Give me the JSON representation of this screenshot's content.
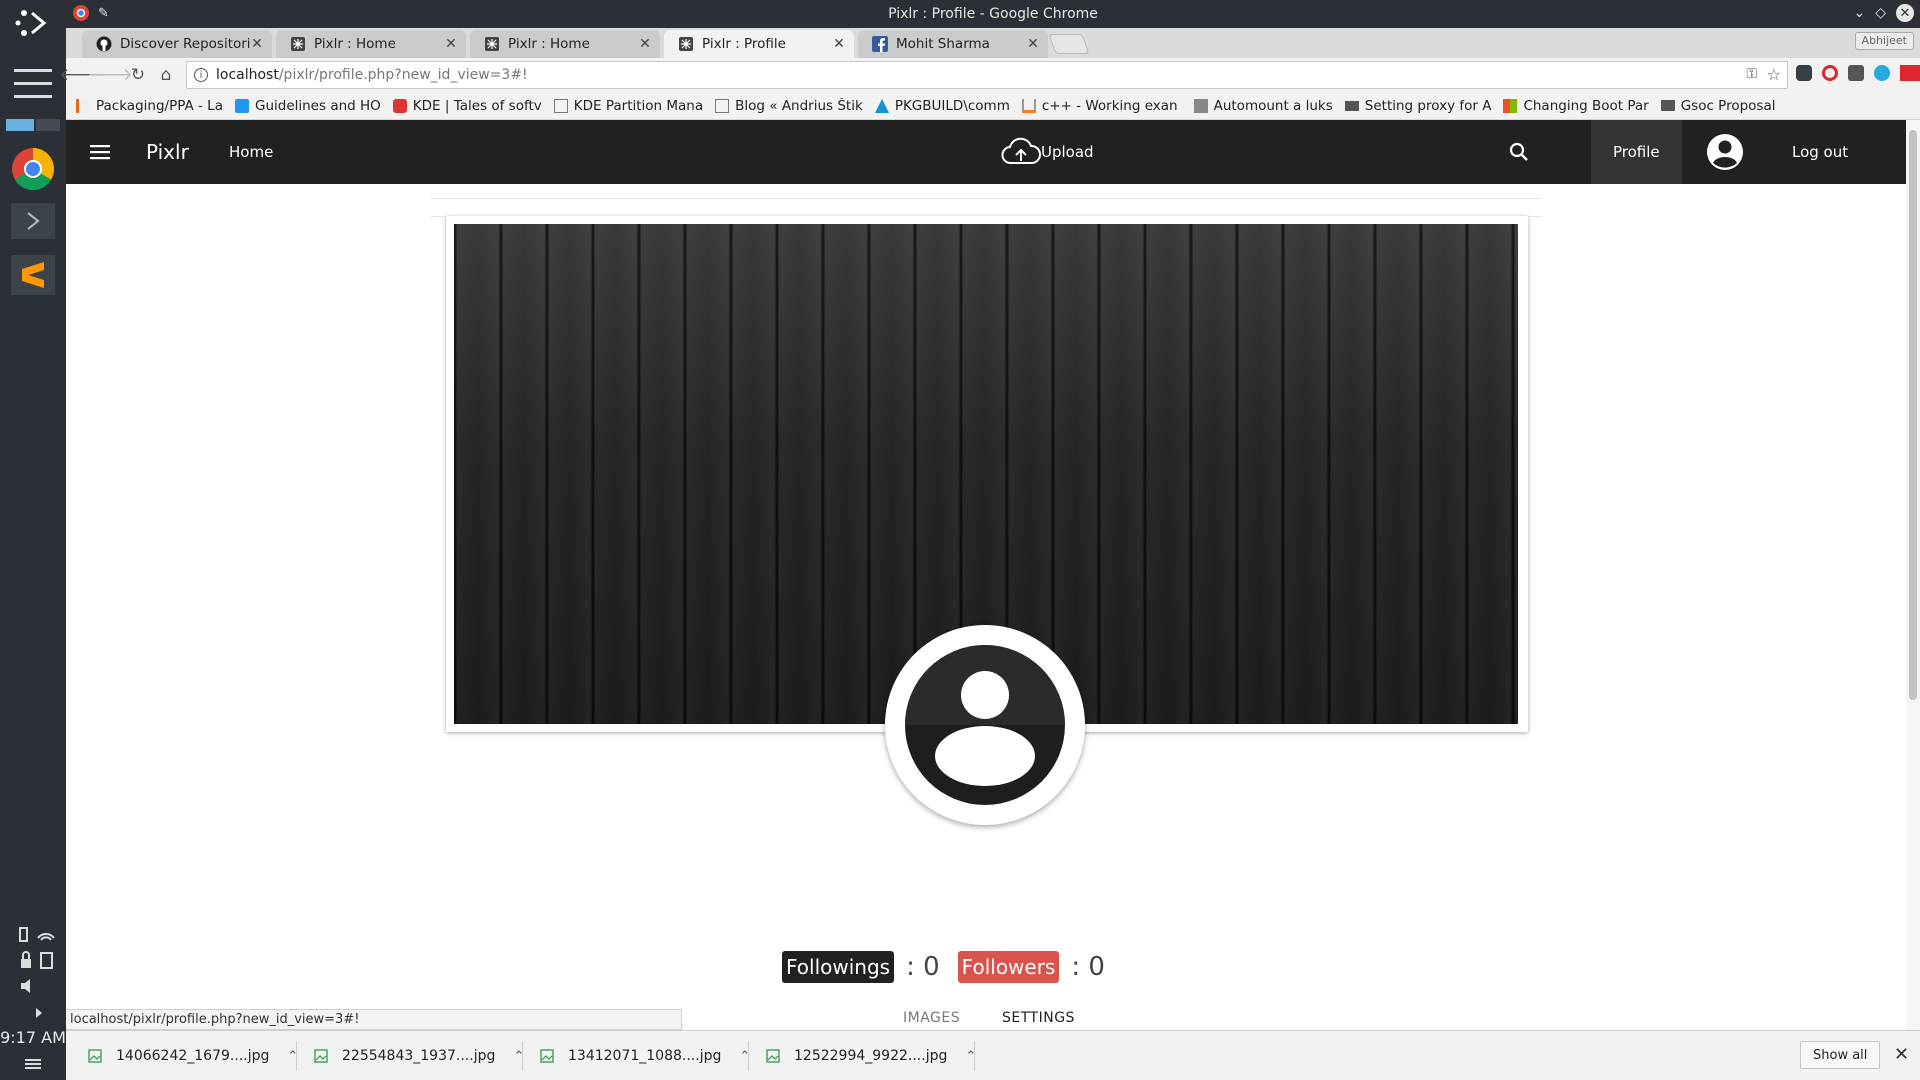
{
  "window": {
    "title": "Pixlr : Profile - Google Chrome"
  },
  "tabs": [
    {
      "title": "Discover Repositories",
      "icon": "github-icon"
    },
    {
      "title": "Pixlr : Home",
      "icon": "pixlr-icon"
    },
    {
      "title": "Pixlr : Home",
      "icon": "pixlr-icon"
    },
    {
      "title": "Pixlr : Profile",
      "icon": "pixlr-icon"
    },
    {
      "title": "Mohit Sharma",
      "icon": "facebook-icon"
    }
  ],
  "profile_badge": "Abhijeet",
  "omnibox": {
    "host": "localhost",
    "path": "/pixlr/profile.php?new_id_view=3#!"
  },
  "bookmarks": [
    {
      "label": "Packaging/PPA - La"
    },
    {
      "label": "Guidelines and HO"
    },
    {
      "label": "KDE | Tales of softv"
    },
    {
      "label": "KDE Partition Mana"
    },
    {
      "label": "Blog « Andrius Štik"
    },
    {
      "label": "PKGBUILD\\comm"
    },
    {
      "label": "c++ - Working exan"
    },
    {
      "label": "Automount a luks"
    },
    {
      "label": "Setting proxy for A"
    },
    {
      "label": "Changing Boot Par"
    },
    {
      "label": "Gsoc Proposal"
    }
  ],
  "navbar": {
    "brand": "Pixlr",
    "home": "Home",
    "upload": "Upload",
    "profile": "Profile",
    "logout": "Log out"
  },
  "follow": {
    "followings_label": "Followings",
    "followings_sep": ": 0",
    "followers_label": "Followers",
    "followers_sep": ": 0"
  },
  "profile_tabs": {
    "images": "IMAGES",
    "settings": "SETTINGS"
  },
  "status_url": "localhost/pixlr/profile.php?new_id_view=3#!",
  "downloads": [
    {
      "name": "14066242_1679....jpg"
    },
    {
      "name": "22554843_1937....jpg"
    },
    {
      "name": "13412071_1088....jpg"
    },
    {
      "name": "12522994_9922....jpg"
    }
  ],
  "show_all": "Show all",
  "clock": "9:17 AM",
  "colors": {
    "navbar": "#212121",
    "followings_badge": "#212121",
    "followers_badge": "#d9534f",
    "accent": "#1a73e8"
  }
}
